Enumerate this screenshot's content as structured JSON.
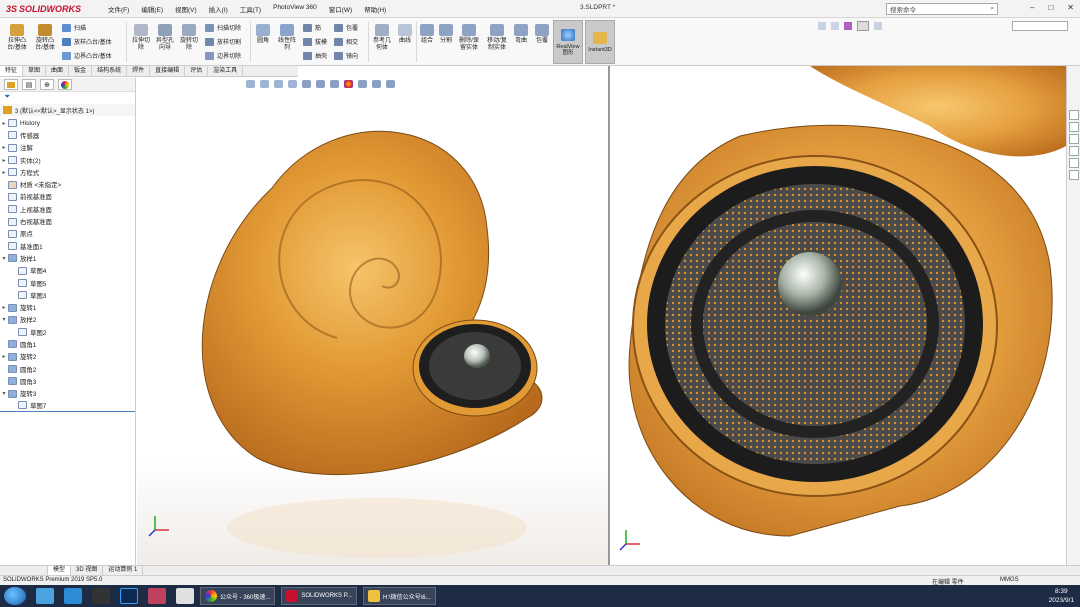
{
  "app": {
    "logo_ds": "3S",
    "logo_name": "SOLIDWORKS",
    "menu": [
      "文件(F)",
      "编辑(E)",
      "视图(V)",
      "插入(I)",
      "工具(T)",
      "PhotoView 360",
      "窗口(W)",
      "帮助(H)"
    ],
    "document_title": "3.SLDPRT *",
    "search_placeholder": "搜索命令",
    "window_controls": [
      "–",
      "□",
      "✕"
    ]
  },
  "ribbon": {
    "big_buttons": [
      {
        "label": "拉伸凸\n台/基体",
        "icon": "extruded-boss-icon"
      },
      {
        "label": "旋转凸\n台/基体",
        "icon": "revolved-boss-icon"
      },
      {
        "label": "拉伸切\n除",
        "icon": "extruded-cut-icon"
      },
      {
        "label": "异型孔\n向导",
        "icon": "hole-wizard-icon"
      },
      {
        "label": "旋转切\n除",
        "icon": "revolved-cut-icon"
      },
      {
        "label": "圆角",
        "icon": "fillet-icon"
      },
      {
        "label": "线性阵\n列",
        "icon": "linear-pattern-icon"
      },
      {
        "label": "参考几\n何体",
        "icon": "reference-geometry-icon"
      },
      {
        "label": "曲线",
        "icon": "curves-icon"
      },
      {
        "label": "组合",
        "icon": "combine-icon"
      },
      {
        "label": "分割",
        "icon": "split-icon"
      },
      {
        "label": "删除/保\n留实体",
        "icon": "delete-body-icon"
      },
      {
        "label": "移动/复\n制实体",
        "icon": "move-copy-icon"
      },
      {
        "label": "弯曲",
        "icon": "flex-icon"
      },
      {
        "label": "包覆",
        "icon": "wrap-icon"
      }
    ],
    "small_buttons": [
      "扫描",
      "放样凸台/基体",
      "边界凸台/基体",
      "扫描切除",
      "放样切割",
      "边界切除",
      "筋",
      "拔模",
      "抽壳",
      "包覆",
      "相交",
      "镜向"
    ],
    "toggle_buttons": [
      "RealView\n图形",
      "Instant3D"
    ]
  },
  "command_tabs": [
    "特征",
    "草图",
    "曲面",
    "钣金",
    "结构系统",
    "焊件",
    "直接编辑",
    "评估",
    "渲染工具"
  ],
  "feature_tree": {
    "root": "3 (默认<<默认>_显示状态 1>)",
    "nodes": [
      {
        "label": "History",
        "arrow": "▸",
        "indent": false
      },
      {
        "label": "传感器",
        "arrow": "",
        "indent": false
      },
      {
        "label": "注解",
        "arrow": "▸",
        "indent": false
      },
      {
        "label": "实体(2)",
        "arrow": "▸",
        "indent": false
      },
      {
        "label": "方程式",
        "arrow": "▸",
        "indent": false
      },
      {
        "label": "材质 <未指定>",
        "arrow": "",
        "indent": false
      },
      {
        "label": "前视基准面",
        "arrow": "",
        "indent": false
      },
      {
        "label": "上视基准面",
        "arrow": "",
        "indent": false
      },
      {
        "label": "右视基准面",
        "arrow": "",
        "indent": false
      },
      {
        "label": "原点",
        "arrow": "",
        "indent": false
      },
      {
        "label": "基准面1",
        "arrow": "",
        "indent": false
      },
      {
        "label": "放样1",
        "arrow": "▾",
        "indent": false
      },
      {
        "label": "草图4",
        "arrow": "",
        "indent": true
      },
      {
        "label": "草图5",
        "arrow": "",
        "indent": true
      },
      {
        "label": "草图3",
        "arrow": "",
        "indent": true
      },
      {
        "label": "旋转1",
        "arrow": "▸",
        "indent": false
      },
      {
        "label": "放样2",
        "arrow": "▾",
        "indent": false
      },
      {
        "label": "草图2",
        "arrow": "",
        "indent": true
      },
      {
        "label": "圆角1",
        "arrow": "",
        "indent": false
      },
      {
        "label": "旋转2",
        "arrow": "▸",
        "indent": false
      },
      {
        "label": "圆角2",
        "arrow": "",
        "indent": false
      },
      {
        "label": "圆角3",
        "arrow": "",
        "indent": false
      },
      {
        "label": "旋转3",
        "arrow": "▾",
        "indent": false
      },
      {
        "label": "草图7",
        "arrow": "",
        "indent": true
      }
    ]
  },
  "bottom_tabs": [
    "模型",
    "3D 视图",
    "运动算例 1"
  ],
  "status": {
    "product": "SOLIDWORKS Premium 2019 SP5.0",
    "mode": "在编辑 零件",
    "units": "MMGS"
  },
  "taskbar": {
    "tasks": [
      {
        "label": "公众号 - 360极速..."
      },
      {
        "label": "SOLIDWORKS P..."
      },
      {
        "label": "H:\\微信公众号\\6..."
      }
    ],
    "time": "8:39",
    "date": "2023/9/1"
  },
  "colors": {
    "accent_red": "#c8102e",
    "wood_orange": "#e0922c",
    "taskbar_bg": "#1d2b44",
    "selection_blue": "#4a7fc1"
  }
}
